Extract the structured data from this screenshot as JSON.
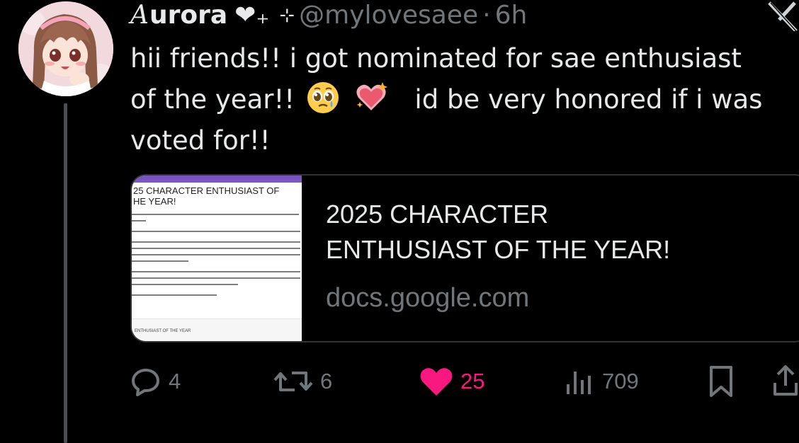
{
  "user": {
    "display_name_initial": "A",
    "display_name_rest": "urora",
    "name_hearts": "❤₊",
    "name_sparkle": "⊹",
    "handle": "@mylovesaee",
    "separator": "·",
    "time": "6h"
  },
  "tweet": {
    "line1": "hii friends!! i got nominated for sae enthusiast",
    "line2_before": "of the year!!",
    "line2_after": "id be very honored if i was",
    "line3": "voted for!!",
    "emojis": [
      "pleading-face-with-tear",
      "sparkling-heart"
    ]
  },
  "card": {
    "title_line1": "2025 CHARACTER",
    "title_line2": "ENTHUSIAST OF THE YEAR!",
    "domain": "docs.google.com",
    "thumbnail": {
      "title_line1": "25 CHARACTER ENTHUSIAST OF",
      "title_line2": "HE YEAR!",
      "footer_text": "ENTHUSIAST OF THE YEAR"
    }
  },
  "actions": {
    "replies": "4",
    "reposts": "6",
    "likes": "25",
    "views": "709"
  },
  "colors": {
    "background": "#000000",
    "text_primary": "#e7e9ea",
    "text_secondary": "#71767b",
    "like_active": "#f91880",
    "border": "#2f3336"
  }
}
